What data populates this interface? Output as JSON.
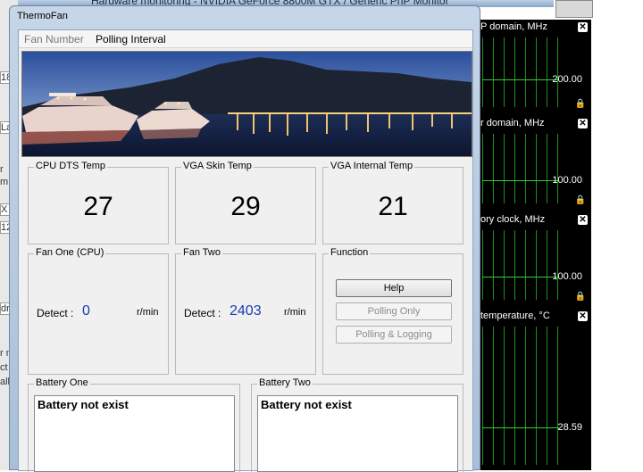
{
  "background_window": {
    "title": "Hardware monitoring - NVIDIA GeForce 8800M GTX / Generic PnP Monitor",
    "left_fragments": [
      "18",
      "La",
      "r",
      "m",
      "X /",
      "12",
      "dri",
      "r n",
      "ct",
      "all"
    ]
  },
  "monitor_graphs": [
    {
      "title": "P domain, MHz",
      "value": "200.00"
    },
    {
      "title": "r domain, MHz",
      "value": "100.00"
    },
    {
      "title": "ory clock, MHz",
      "value": "100.00"
    },
    {
      "title": "temperature, °C",
      "value": "28.59"
    }
  ],
  "thermofan": {
    "title": "ThermoFan",
    "menu": {
      "fan_number": "Fan Number",
      "polling_interval": "Polling Interval"
    },
    "temps": [
      {
        "label": "CPU DTS Temp",
        "value": "27"
      },
      {
        "label": "VGA Skin Temp",
        "value": "29"
      },
      {
        "label": "VGA Internal Temp",
        "value": "21"
      }
    ],
    "fans": [
      {
        "label": "Fan One (CPU)",
        "detect_label": "Detect :",
        "value": "0",
        "unit": "r/min"
      },
      {
        "label": "Fan Two",
        "detect_label": "Detect :",
        "value": "2403",
        "unit": "r/min"
      }
    ],
    "function": {
      "label": "Function",
      "help": "Help",
      "polling_only": "Polling Only",
      "polling_logging": "Polling & Logging"
    },
    "batteries": [
      {
        "label": "Battery One",
        "status": "Battery not exist"
      },
      {
        "label": "Battery Two",
        "status": "Battery not exist"
      }
    ]
  },
  "colors": {
    "fan_value": "#1a3cb0",
    "graph_line": "#2fd12f",
    "graph_bg": "#000000"
  }
}
